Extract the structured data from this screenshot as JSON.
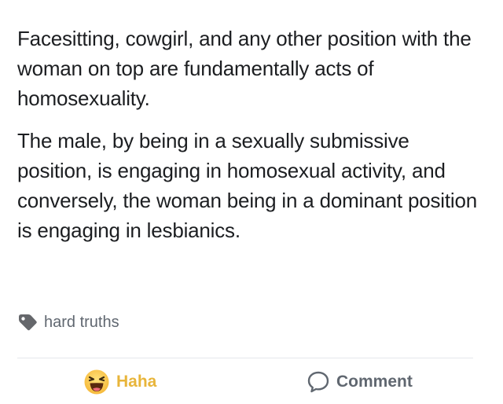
{
  "post": {
    "paragraphs": [
      "Facesitting, cowgirl, and any other position with the woman on top are fundamentally acts of homosexuality.",
      "The male, by being in a sexually submissive position, is engaging in homosexual activity, and conversely, the woman being in a dominant position is engaging in lesbianics."
    ],
    "tag": {
      "icon": "tag-icon",
      "label": "hard truths"
    }
  },
  "actions": {
    "haha": {
      "icon": "haha-emoji-icon",
      "label": "Haha",
      "color": "#e8b53b"
    },
    "comment": {
      "icon": "comment-bubble-icon",
      "label": "Comment",
      "color": "#606770"
    }
  }
}
